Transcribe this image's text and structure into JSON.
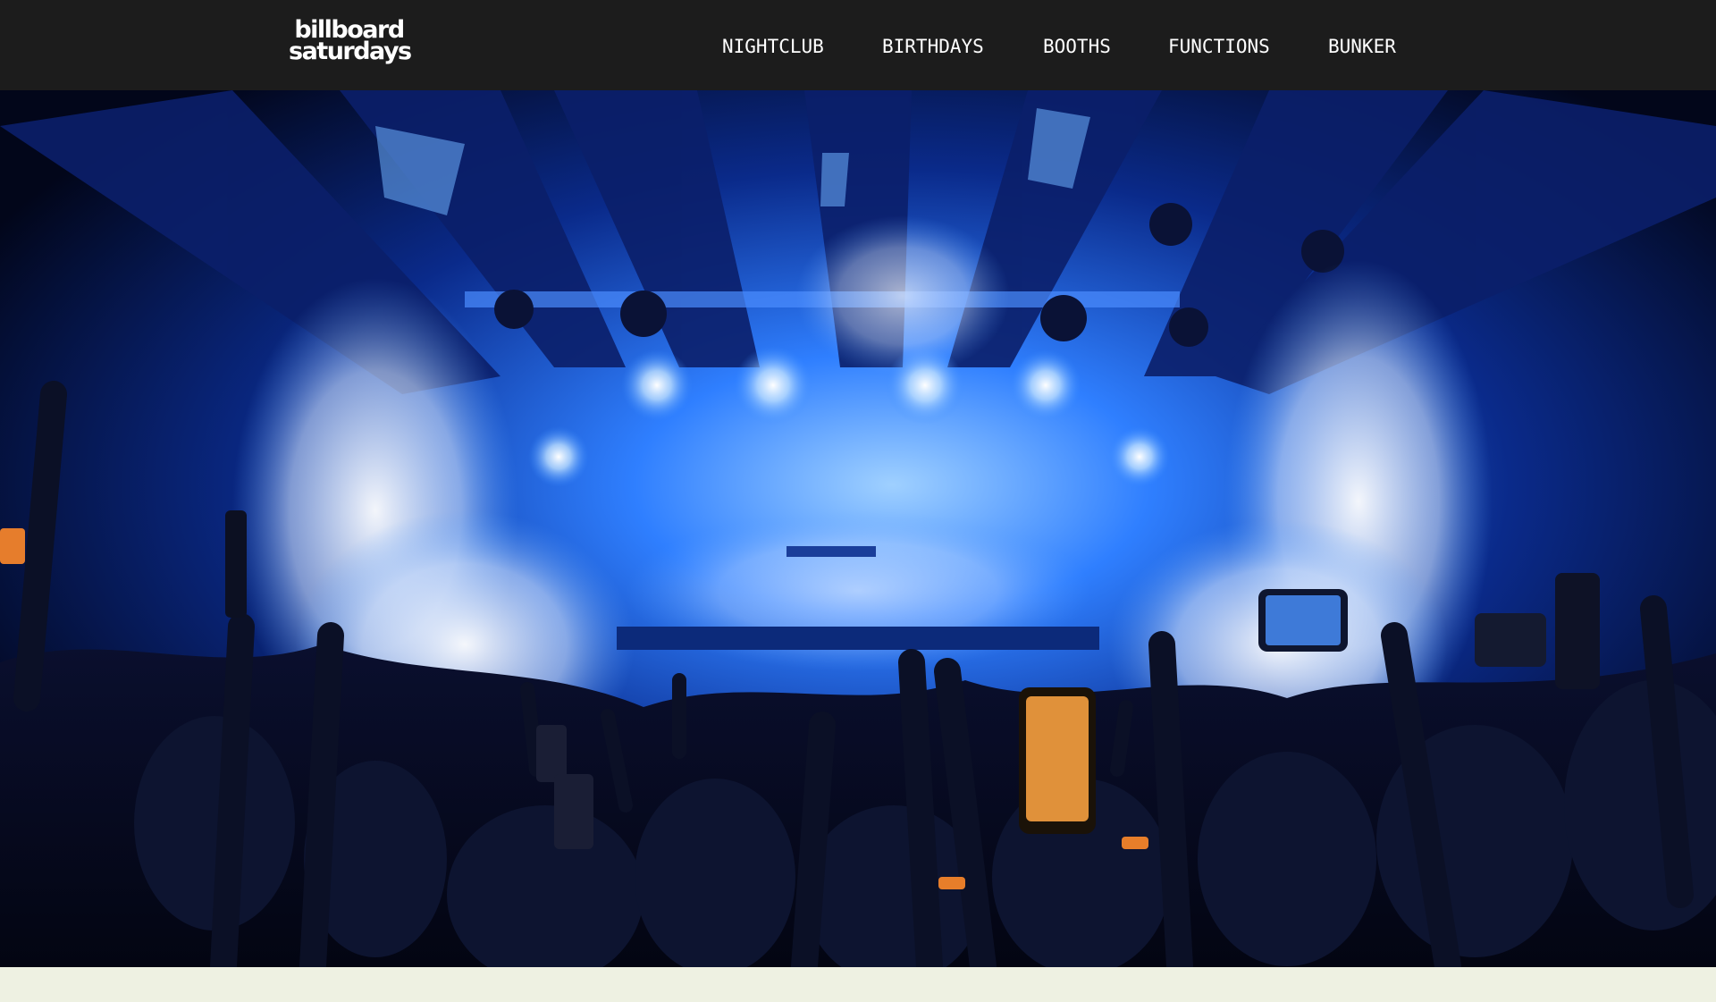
{
  "brand": {
    "line1": "billboard",
    "line2": "saturdays"
  },
  "nav": {
    "items": [
      {
        "label": "NIGHTCLUB"
      },
      {
        "label": "BIRTHDAYS"
      },
      {
        "label": "BOOTHS"
      },
      {
        "label": "FUNCTIONS"
      },
      {
        "label": "BUNKER"
      }
    ]
  },
  "hero": {
    "image": "nightclub-crowd-stage-photo"
  },
  "colors": {
    "header_bg": "#1c1c1c",
    "page_bg": "#eef1e2",
    "nav_text": "#ffffff",
    "stage_light": "#2f7fff"
  }
}
